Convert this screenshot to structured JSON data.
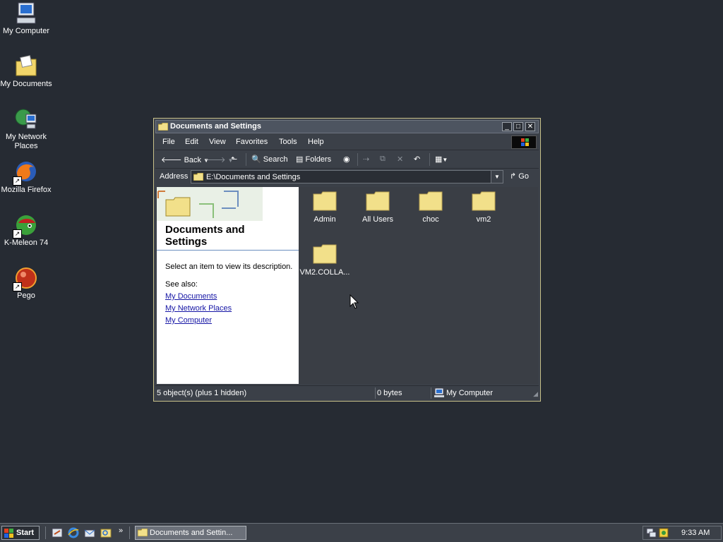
{
  "desktop": {
    "icons": [
      {
        "label": "My Computer",
        "icon": "computer-icon"
      },
      {
        "label": "My Documents",
        "icon": "documents-folder-icon"
      },
      {
        "label": "My Network Places",
        "icon": "network-places-icon"
      },
      {
        "label": "Mozilla Firefox",
        "icon": "firefox-icon"
      },
      {
        "label": "K-Meleon 74",
        "icon": "kmeleon-icon"
      },
      {
        "label": "Pego",
        "icon": "pego-icon"
      }
    ]
  },
  "window": {
    "title": "Documents and Settings",
    "menu": [
      "File",
      "Edit",
      "View",
      "Favorites",
      "Tools",
      "Help"
    ],
    "toolbar": {
      "back": "Back",
      "search": "Search",
      "folders": "Folders"
    },
    "address": {
      "label": "Address",
      "value": "E:\\Documents and Settings",
      "go": "Go"
    },
    "task_pane": {
      "title": "Documents and Settings",
      "description": "Select an item to view its description.",
      "see_also": "See also:",
      "links": [
        "My Documents",
        "My Network Places",
        "My Computer"
      ]
    },
    "folders": [
      "Admin",
      "All Users",
      "choc",
      "vm2",
      "VM2.COLLA..."
    ],
    "status": {
      "objects": "5 object(s) (plus 1 hidden)",
      "size": "0 bytes",
      "zone": "My Computer"
    }
  },
  "taskbar": {
    "start": "Start",
    "task": "Documents and Settin...",
    "clock": "9:33 AM",
    "overflow": "»"
  },
  "colors": {
    "desktop": "#262b33",
    "window": "#3b4048",
    "folder": "#f2e08a",
    "link": "#1515a5"
  }
}
